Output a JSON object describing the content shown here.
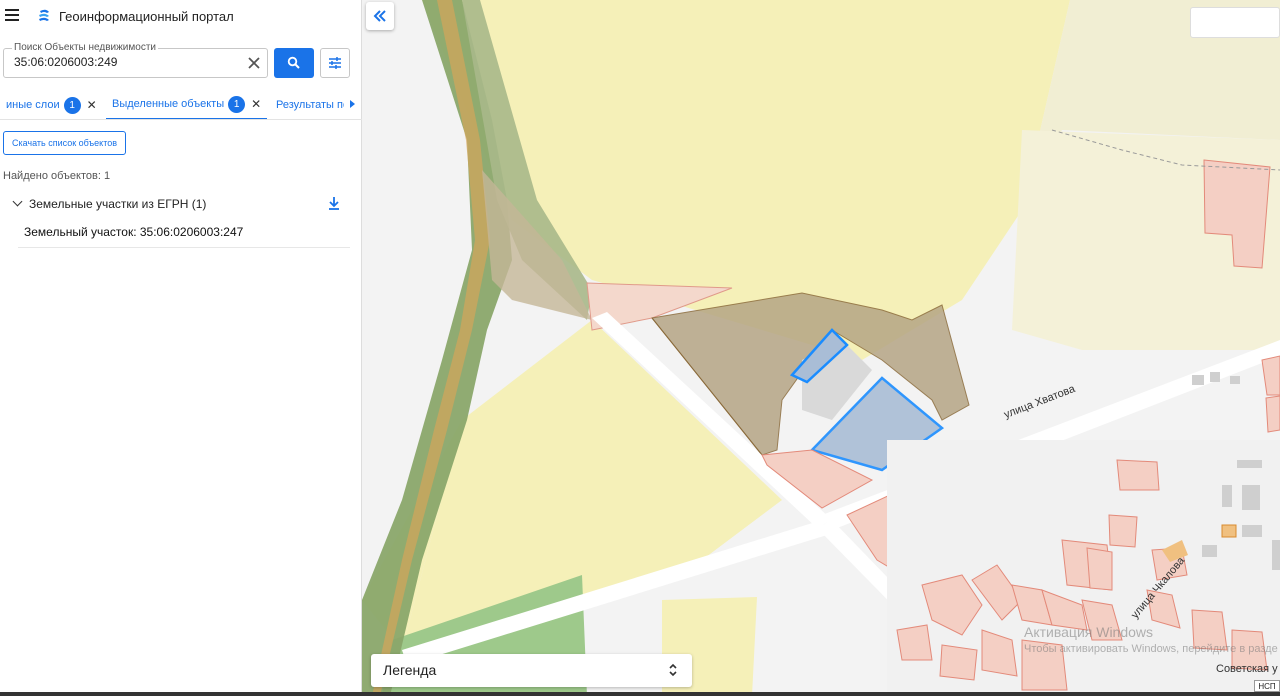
{
  "header": {
    "title": "Геоинформационный портал"
  },
  "search": {
    "label": "Поиск Объекты недвижимости",
    "value": "35:06:0206003:249"
  },
  "tabs": [
    {
      "label": "иные слои",
      "badge": "1"
    },
    {
      "label": "Выделенные объекты",
      "badge": "1"
    },
    {
      "label": "Результаты по"
    }
  ],
  "results": {
    "download_list_label": "Скачать список объектов",
    "found_label": "Найдено объектов: 1",
    "group_label": "Земельные участки из ЕГРН (1)",
    "item_label": "Земельный участок: 35:06:0206003:247"
  },
  "map": {
    "legend_label": "Легенда",
    "streets": {
      "khvatova": "улица Хватова",
      "chkalova": "улица Чкалова",
      "sovetskaya": "Советская у"
    },
    "badge": "НСП"
  },
  "watermark": {
    "line1": "Активация Windows",
    "line2": "Чтобы активировать Windows, перейдите в разде"
  },
  "colors": {
    "accent": "#1a73e8",
    "field_yellow": "#f5f0b8",
    "parcel_brown": "#b5a585",
    "parcel_pink": "#f4cfc4",
    "selected_blue": "#1a8cff",
    "road_green": "#8aa66a"
  },
  "icons": {
    "menu": "menu-icon",
    "logo": "portal-logo-icon",
    "clear": "close-icon",
    "search": "search-icon",
    "filter": "tune-icon",
    "collapse": "double-chevron-left-icon",
    "download": "download-icon",
    "expand": "chevron-down-icon",
    "legend_toggle": "unfold-icon"
  }
}
